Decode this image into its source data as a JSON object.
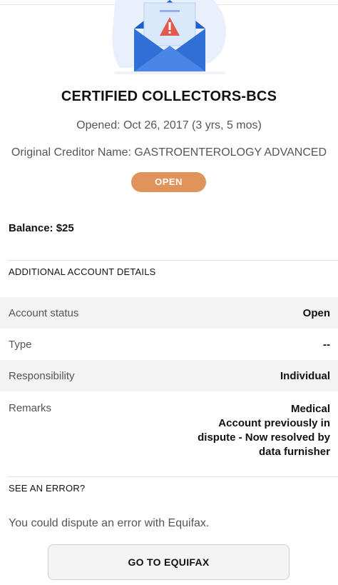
{
  "account": {
    "title": "CERTIFIED COLLECTORS-BCS",
    "opened": "Opened: Oct 26, 2017 (3 yrs, 5 mos)",
    "creditor": "Original Creditor Name: GASTROENTEROLOGY ADVANCED",
    "status_pill": "OPEN",
    "balance": "Balance: $25"
  },
  "details": {
    "heading": "ADDITIONAL ACCOUNT DETAILS",
    "rows": [
      {
        "label": "Account status",
        "value": "Open"
      },
      {
        "label": "Type",
        "value": "--"
      },
      {
        "label": "Responsibility",
        "value": "Individual"
      },
      {
        "label": "Remarks",
        "value_lines": [
          "Medical",
          "Account previously in",
          "dispute - Now resolved by",
          "data furnisher"
        ]
      }
    ]
  },
  "error": {
    "heading": "SEE AN ERROR?",
    "text": "You could dispute an error with Equifax.",
    "button": "GO TO EQUIFAX"
  },
  "icons": {
    "hero": "envelope-alert-icon"
  },
  "colors": {
    "pill": "#e0935a",
    "envelope": "#2f6fd6",
    "alert": "#e05a4f"
  }
}
